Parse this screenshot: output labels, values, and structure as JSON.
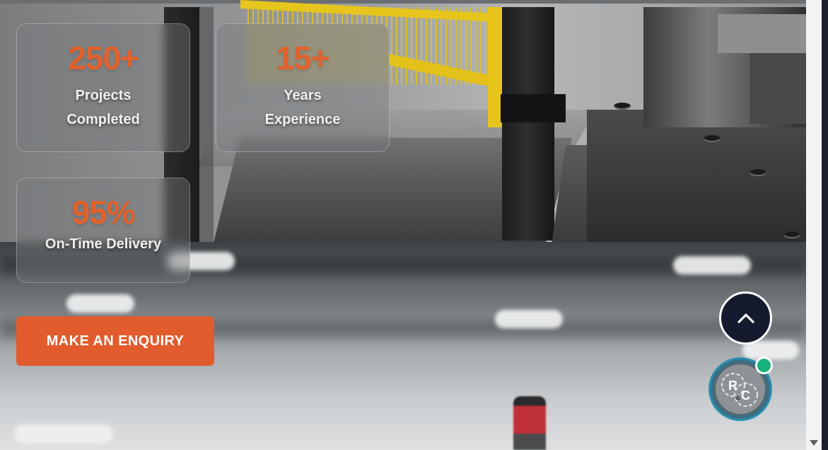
{
  "stats": [
    {
      "value": "250+",
      "label": "Projects Completed"
    },
    {
      "value": "15+",
      "label": "Years Experience"
    },
    {
      "value": "95%",
      "label": "On-Time Delivery"
    }
  ],
  "cta": {
    "label": "MAKE AN ENQUIRY"
  },
  "floating": {
    "scroll_top_icon": "chevron-up-icon",
    "chat_icon": "company-logo-rc",
    "chat_logo_letters": "R & C",
    "online_status": "online"
  },
  "colors": {
    "accent": "#e15b2c",
    "stat_value": "#e2612c",
    "scroll_button_bg": "#161a2e",
    "chat_ring": "#2a8fb0",
    "online": "#18b27a"
  }
}
